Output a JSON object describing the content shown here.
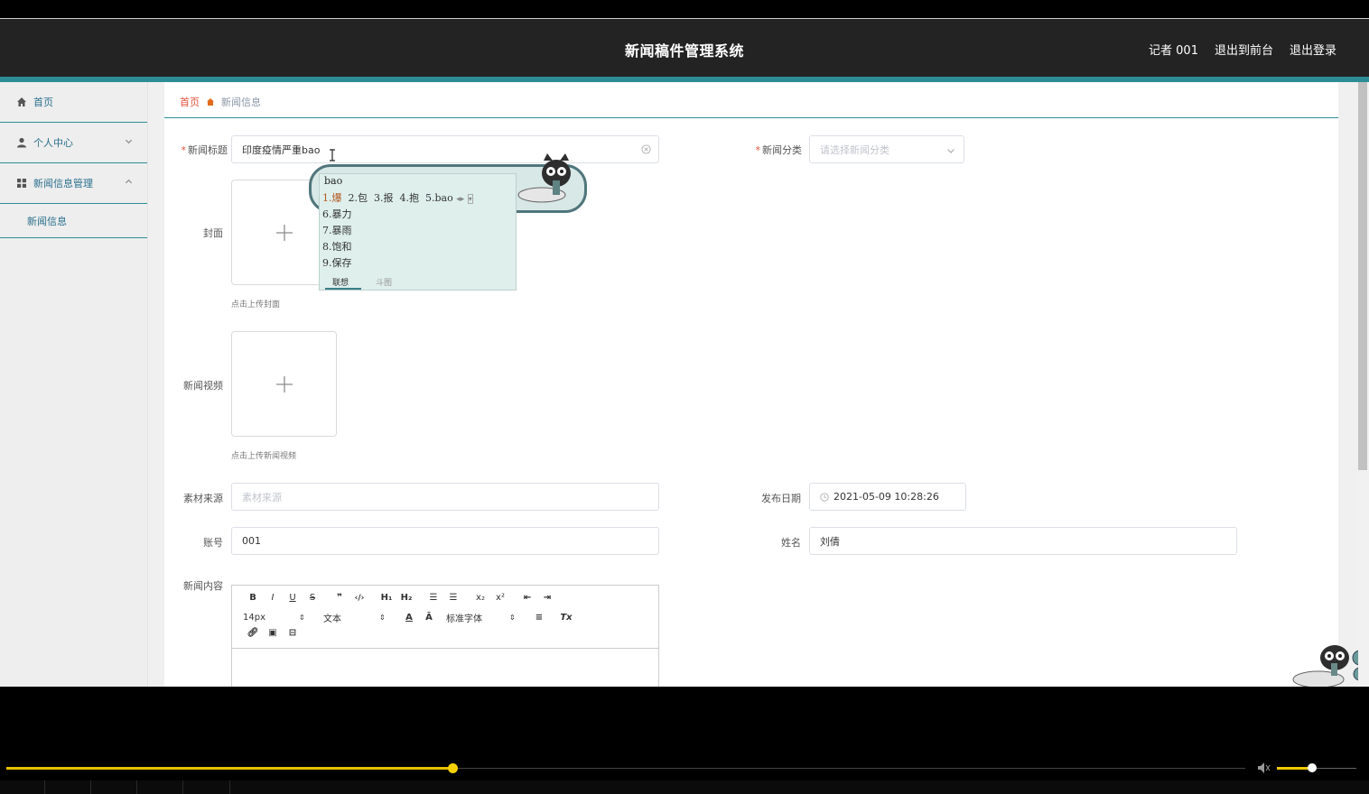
{
  "header": {
    "title": "新闻稿件管理系统",
    "user": "记者 001",
    "to_front": "退出到前台",
    "logout": "退出登录"
  },
  "sidebar": {
    "items": [
      {
        "label": "首页",
        "icon": "home-icon"
      },
      {
        "label": "个人中心",
        "icon": "user-icon"
      },
      {
        "label": "新闻信息管理",
        "icon": "grid-icon"
      }
    ],
    "sub_item": "新闻信息"
  },
  "breadcrumb": {
    "home": "首页",
    "current": "新闻信息"
  },
  "form": {
    "title_label": "新闻标题",
    "title_value": "印度疫情严重bao",
    "category_label": "新闻分类",
    "category_placeholder": "请选择新闻分类",
    "cover_label": "封面",
    "cover_hint": "点击上传封面",
    "video_label": "新闻视频",
    "video_hint": "点击上传新闻视频",
    "source_label": "素材来源",
    "source_placeholder": "素材来源",
    "date_label": "发布日期",
    "date_value": "2021-05-09 10:28:26",
    "account_label": "账号",
    "account_value": "001",
    "name_label": "姓名",
    "name_value": "刘倩",
    "content_label": "新闻内容"
  },
  "editor": {
    "font_size": "14px",
    "block_type": "文本",
    "font_family": "标准字体"
  },
  "ime": {
    "pinyin": "bao",
    "row1": [
      "1.爆",
      "2.包",
      "3.报",
      "4.抱",
      "5.bao"
    ],
    "candidates": [
      "6.暴力",
      "7.暴雨",
      "8.饱和",
      "9.保存"
    ],
    "tab1": "联想",
    "tab2": "斗图"
  },
  "player": {
    "progress": 0.36,
    "volume": 0.44
  }
}
